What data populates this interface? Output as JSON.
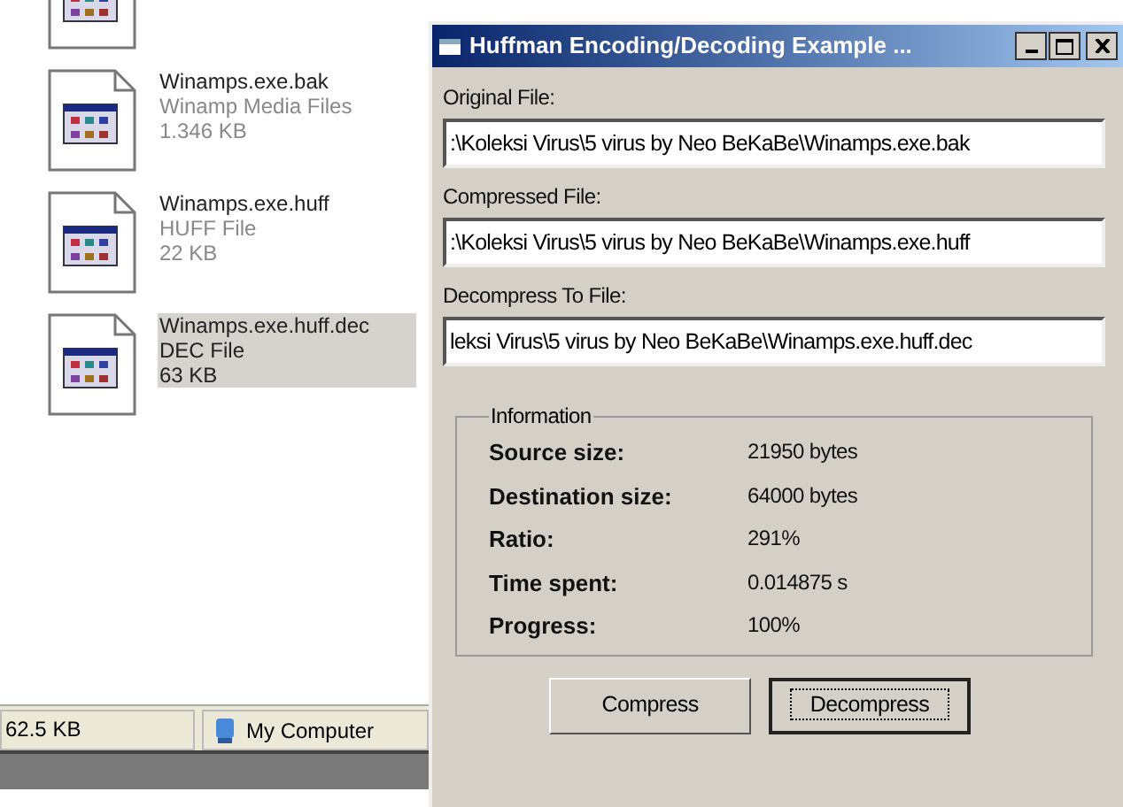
{
  "files": [
    {
      "name": "Winamps.exe.bak",
      "type": "Winamp Media Files",
      "size": "1.346 KB",
      "selected": false
    },
    {
      "name": "Winamps.exe.huff",
      "type": "HUFF File",
      "size": "22 KB",
      "selected": false
    },
    {
      "name": "Winamps.exe.huff.dec",
      "type": "DEC File",
      "size": "63 KB",
      "selected": true
    }
  ],
  "status_bar": {
    "size": "62.5 KB",
    "location": "My Computer"
  },
  "window": {
    "title": "Huffman Encoding/Decoding Example ..."
  },
  "fields": [
    {
      "label": "Original File:",
      "value": ":\\Koleksi Virus\\5 virus by Neo BeKaBe\\Winamps.exe.bak"
    },
    {
      "label": "Compressed File:",
      "value": ":\\Koleksi Virus\\5 virus by Neo BeKaBe\\Winamps.exe.huff"
    },
    {
      "label": "Decompress To File:",
      "value": "leksi Virus\\5 virus by Neo BeKaBe\\Winamps.exe.huff.dec"
    }
  ],
  "information": {
    "title": "Information",
    "rows": [
      {
        "label": "Source size:",
        "value": "21950 bytes"
      },
      {
        "label": "Destination size:",
        "value": "64000 bytes"
      },
      {
        "label": "Ratio:",
        "value": "291%"
      },
      {
        "label": "Time spent:",
        "value": "0.014875 s"
      },
      {
        "label": "Progress:",
        "value": "100%"
      }
    ]
  },
  "buttons": [
    {
      "label": "Compress",
      "focused": false
    },
    {
      "label": "Decompress",
      "focused": true
    }
  ]
}
